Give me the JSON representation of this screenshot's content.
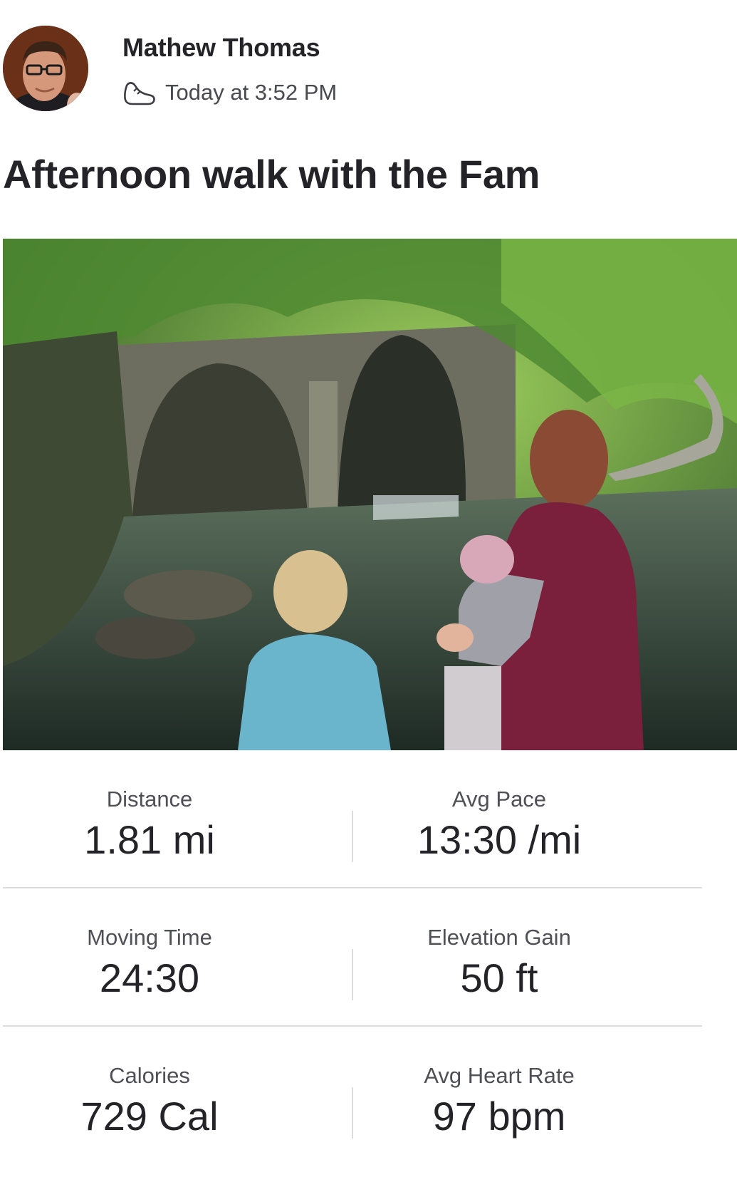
{
  "activity": {
    "athlete_name": "Mathew Thomas",
    "timestamp": "Today at 3:52 PM",
    "sport_icon": "shoe-icon",
    "title": "Afternoon walk with the Fam"
  },
  "stats": [
    [
      {
        "label": "Distance",
        "value": "1.81 mi"
      },
      {
        "label": "Avg Pace",
        "value": "13:30 /mi"
      }
    ],
    [
      {
        "label": "Moving Time",
        "value": "24:30"
      },
      {
        "label": "Elevation Gain",
        "value": "50 ft"
      }
    ],
    [
      {
        "label": "Calories",
        "value": "729 Cal"
      },
      {
        "label": "Avg Heart Rate",
        "value": "97 bpm"
      }
    ]
  ],
  "colors": {
    "text": "#242428",
    "secondary_text": "#494950",
    "divider": "#dcdcdf"
  }
}
